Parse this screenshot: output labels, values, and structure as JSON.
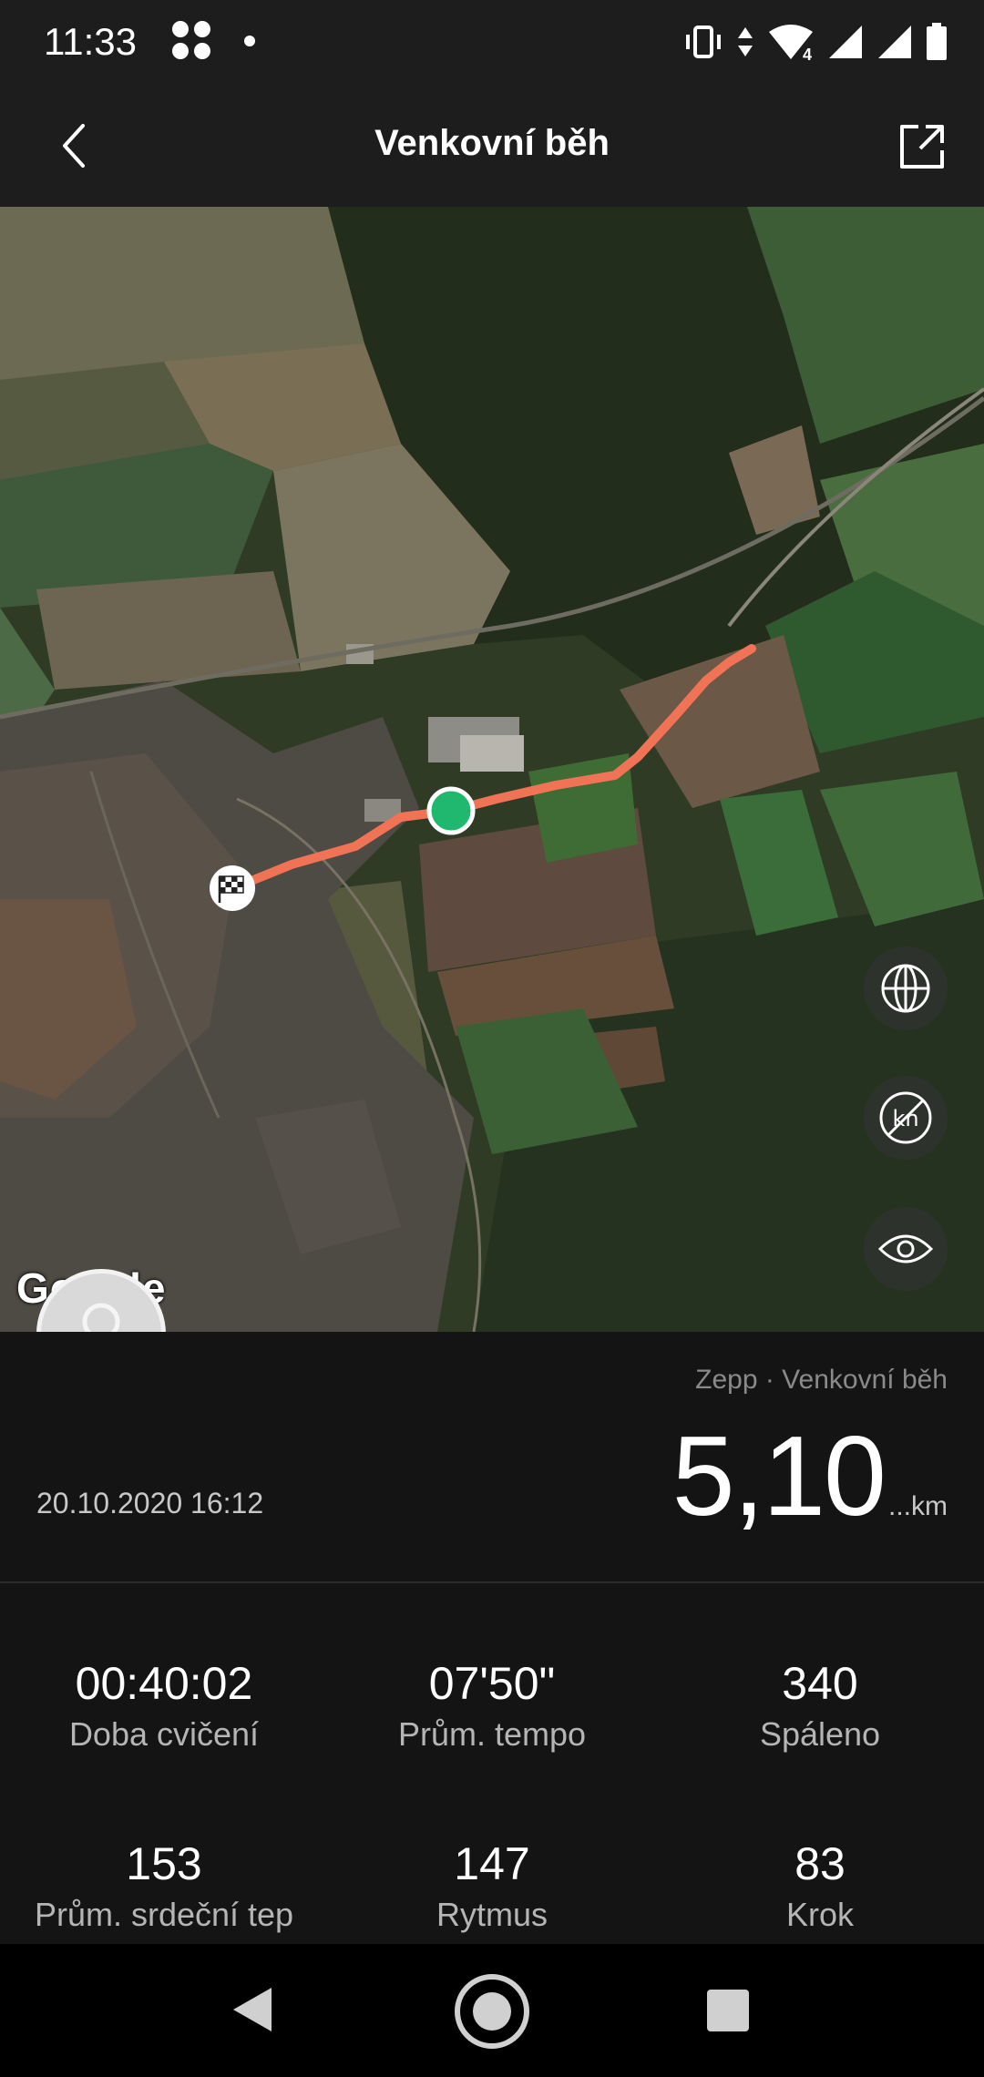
{
  "status_bar": {
    "time": "11:33",
    "network_label": "4",
    "icons": [
      "app-notification-icon",
      "notification-dot",
      "vibrate-icon",
      "data-arrows-icon",
      "wifi-icon",
      "signal-icon",
      "signal-icon",
      "battery-icon"
    ]
  },
  "header": {
    "title": "Venkovní běh",
    "back_icon": "chevron-left-icon",
    "share_icon": "share-external-icon"
  },
  "map": {
    "attribution": "Google",
    "controls": [
      "globe-icon",
      "km-toggle-icon",
      "eye-icon"
    ],
    "route_color": "#f07356",
    "start_marker_color": "#1fb86e",
    "finish_marker": "checkered-flag-icon"
  },
  "summary": {
    "source": "Zepp · Venkovní běh",
    "datetime": "20.10.2020 16:12",
    "distance_value": "5,10",
    "distance_unit": "...km"
  },
  "stats": [
    {
      "value": "00:40:02",
      "label": "Doba cvičení"
    },
    {
      "value": "07'50\"",
      "label": "Prům. tempo"
    },
    {
      "value": "340",
      "label": "Spáleno"
    },
    {
      "value": "153",
      "label": "Prům. srdeční tep"
    },
    {
      "value": "147",
      "label": "Rytmus"
    },
    {
      "value": "83",
      "label": "Krok"
    }
  ],
  "nav_bar": {
    "buttons": [
      "nav-back-icon",
      "nav-home-icon",
      "nav-recents-icon"
    ]
  }
}
